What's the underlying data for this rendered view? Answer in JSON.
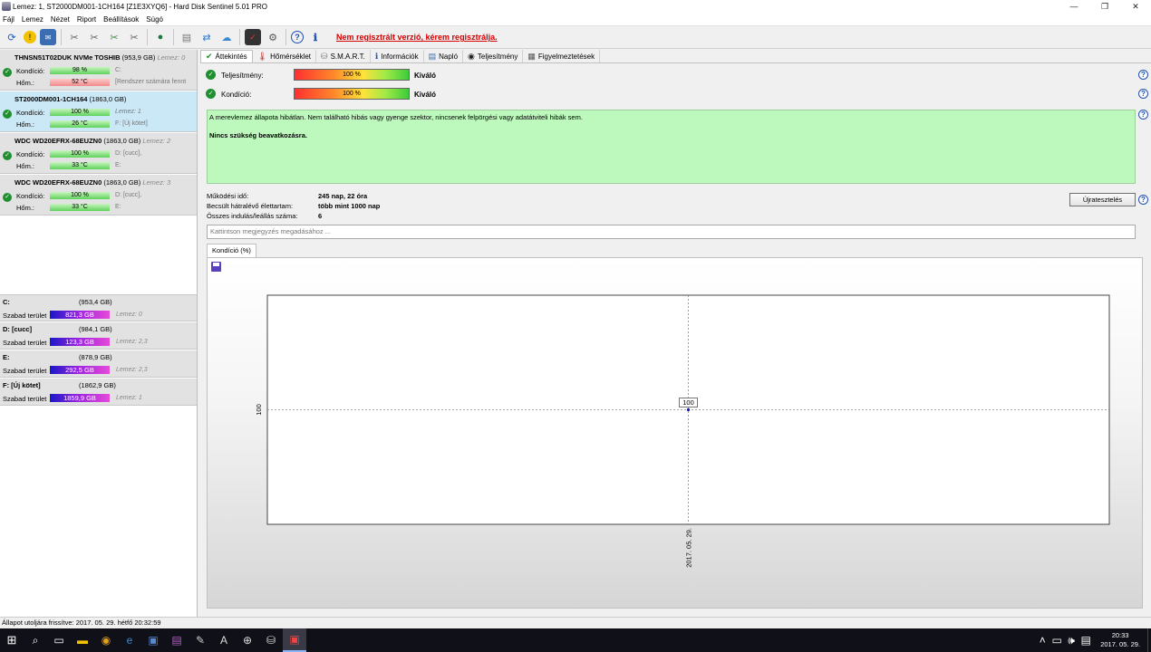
{
  "window": {
    "title": "Lemez: 1, ST2000DM001-1CH164 [Z1E3XYQ6]  -  Hard Disk Sentinel 5.01 PRO",
    "controls": [
      "—",
      "❐",
      "✕"
    ]
  },
  "menu": [
    "Fájl",
    "Lemez",
    "Nézet",
    "Riport",
    "Beállítások",
    "Súgó"
  ],
  "toolbar": {
    "register_link": "Nem regisztrált verzió, kérem regisztrálja."
  },
  "disks": [
    {
      "name": "THNSN51T02DUK NVMe TOSHIB",
      "size": "(953,9 GB)",
      "lemez": "Lemez: 0",
      "kondicio_label": "Kondíció:",
      "kondicio": "98 %",
      "drive": "C:",
      "hom_label": "Hőm.:",
      "hom": "52 °C",
      "hom_status": "red",
      "extra": "[Rendszer számára fennt"
    },
    {
      "name": "ST2000DM001-1CH164",
      "size": "(1863,0 GB)",
      "lemez": "",
      "kondicio_label": "Kondíció:",
      "kondicio": "100 %",
      "drive": "Lemez: 1",
      "hom_label": "Hőm.:",
      "hom": "26 °C",
      "hom_status": "green",
      "extra": "F: [Új kötet]"
    },
    {
      "name": "WDC WD20EFRX-68EUZN0",
      "size": "(1863,0 GB)",
      "lemez": "Lemez: 2",
      "kondicio_label": "Kondíció:",
      "kondicio": "100 %",
      "drive": "D: [cucc],",
      "hom_label": "Hőm.:",
      "hom": "33 °C",
      "hom_status": "green",
      "extra": "E:"
    },
    {
      "name": "WDC WD20EFRX-68EUZN0",
      "size": "(1863,0 GB)",
      "lemez": "Lemez: 3",
      "kondicio_label": "Kondíció:",
      "kondicio": "100 %",
      "drive": "D: [cucc],",
      "hom_label": "Hőm.:",
      "hom": "33 °C",
      "hom_status": "green",
      "extra": "E:"
    }
  ],
  "volumes": [
    {
      "name": "C:",
      "size": "(953,4 GB)",
      "free_label": "Szabad terület",
      "free": "821,3 GB",
      "lemez": "Lemez: 0"
    },
    {
      "name": "D: [cucc]",
      "size": "(984,1 GB)",
      "free_label": "Szabad terület",
      "free": "123,3 GB",
      "lemez": "Lemez: 2,3"
    },
    {
      "name": "E:",
      "size": "(878,9 GB)",
      "free_label": "Szabad terület",
      "free": "292,5 GB",
      "lemez": "Lemez: 2,3"
    },
    {
      "name": "F: [Új kötet]",
      "size": "(1862,9 GB)",
      "free_label": "Szabad terület",
      "free": "1859,9 GB",
      "lemez": "Lemez: 1"
    }
  ],
  "tabs": [
    "Áttekintés",
    "Hőmérséklet",
    "S.M.A.R.T.",
    "Információk",
    "Napló",
    "Teljesítmény",
    "Figyelmeztetések"
  ],
  "overview": {
    "performance_label": "Teljesítmény:",
    "performance_value": "100 %",
    "performance_text": "Kiváló",
    "condition_label": "Kondíció:",
    "condition_value": "100 %",
    "condition_text": "Kiváló",
    "status_line1": "A merevlemez állapota hibátlan. Nem található hibás vagy gyenge szektor, nincsenek felpörgési vagy adatátviteli hibák sem.",
    "status_line2": "Nincs szükség beavatkozásra.",
    "uptime_label": "Működési idő:",
    "uptime_value": "245 nap, 22 óra",
    "lifetime_label": "Becsült hátralévő élettartam:",
    "lifetime_value": "több mint 1000 nap",
    "startstop_label": "Összes indulás/leállás száma:",
    "startstop_value": "6",
    "retest_button": "Újratesztelés",
    "note_placeholder": "Kattintson megjegyzés megadásához ...",
    "chart_tab": "Kondíció  (%)"
  },
  "chart_data": {
    "type": "line",
    "x": [
      "2017. 05. 29."
    ],
    "series": [
      {
        "values": [
          100
        ]
      }
    ],
    "ytick": "100",
    "data_label": "100",
    "grid": true
  },
  "statusbar": "Állapot utoljára frissítve: 2017. 05. 29. hétfő 20:32:59",
  "taskbar": {
    "time": "20:33",
    "date": "2017. 05. 29."
  }
}
